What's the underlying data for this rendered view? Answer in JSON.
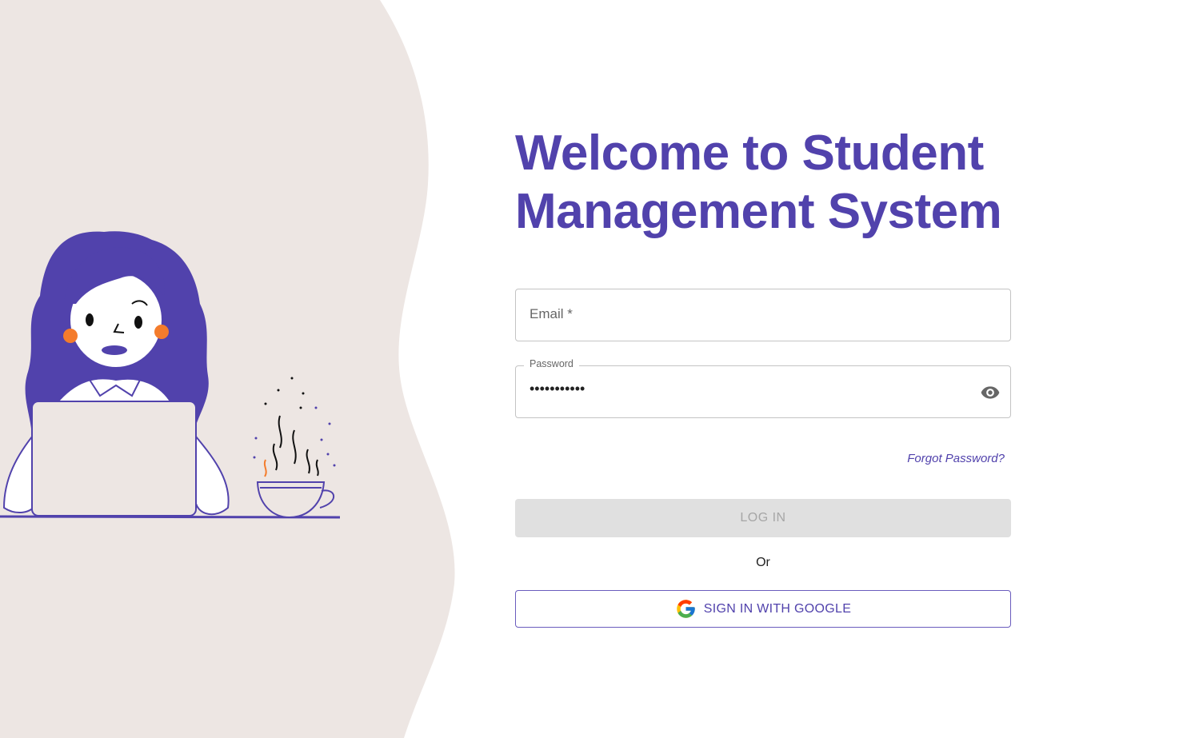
{
  "heading": {
    "line1": "Welcome to Student",
    "line2": "Management System"
  },
  "form": {
    "email": {
      "label": "Email *",
      "value": ""
    },
    "password": {
      "label": "Password",
      "value": "•••••••••••",
      "toggle_icon": "eye-icon"
    },
    "forgot_password": "Forgot Password?",
    "login_button": "LOG IN",
    "separator": "Or",
    "google_button": "SIGN IN WITH GOOGLE",
    "google_icon": "google-g-icon"
  },
  "colors": {
    "brand": "#5142ac",
    "background_shape": "#ede6e3",
    "orange_accent": "#f47c2c",
    "disabled_button": "#e0e0e0"
  }
}
